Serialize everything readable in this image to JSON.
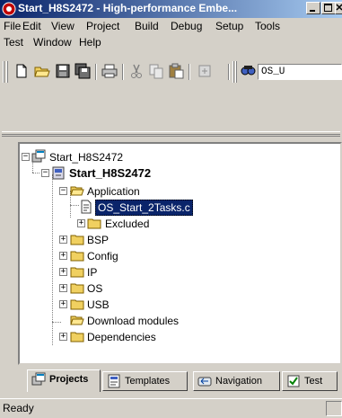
{
  "window": {
    "title": "Start_H8S2472 - High-performance Embe...",
    "colors": {
      "titlebar_start": "#0a246a",
      "titlebar_end": "#a6caf0",
      "face": "#d4d0c8"
    }
  },
  "menu": {
    "items": [
      "File",
      "Edit",
      "View",
      "Project",
      "Build",
      "Debug",
      "Setup",
      "Tools",
      "Test",
      "Window",
      "Help"
    ]
  },
  "toolbar": {
    "buttons": [
      "new-file-icon",
      "open-folder-icon",
      "save-icon",
      "save-all-icon",
      "print-icon",
      "cut-icon",
      "copy-icon",
      "paste-icon",
      "build-icon",
      "find-icon"
    ],
    "combo_value": "OS_U"
  },
  "tree": {
    "workspace": "Start_H8S2472",
    "project": "Start_H8S2472",
    "application": "Application",
    "selected_file": "OS_Start_2Tasks.c",
    "excluded": "Excluded",
    "bsp": "BSP",
    "config": "Config",
    "ip": "IP",
    "os": "OS",
    "usb": "USB",
    "download_modules": "Download modules",
    "dependencies": "Dependencies"
  },
  "tabs": {
    "projects": "Projects",
    "templates": "Templates",
    "navigation": "Navigation",
    "test": "Test"
  },
  "status": {
    "text": "Ready"
  }
}
